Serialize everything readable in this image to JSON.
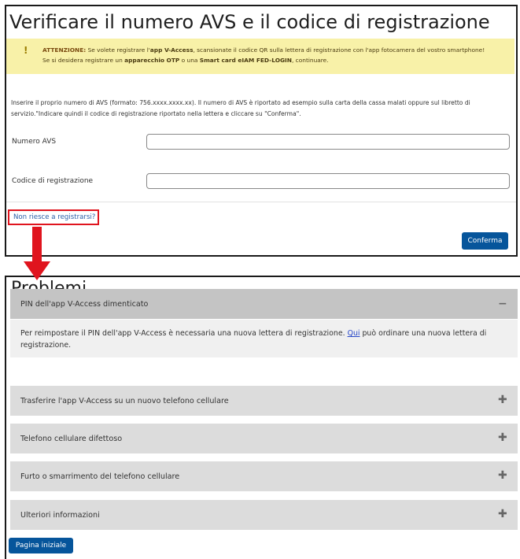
{
  "top": {
    "title": "Verificare il numero AVS e il codice di registrazione",
    "warning": {
      "mark": "!",
      "line1_prefix": "ATTENZIONE:",
      "line1_a": " Se volete registrare l'",
      "line1_b": "app V-Access",
      "line1_c": ", scansionate il codice QR sulla lettera di registrazione con l'app fotocamera del vostro smartphone!",
      "line2_a": "Se si desidera registrare un ",
      "line2_b": "apparecchio OTP",
      "line2_c": " o una ",
      "line2_d": "Smart card eIAM FED-LOGIN",
      "line2_e": ", continuare."
    },
    "instructions_line1": "Inserire il proprio numero di AVS (formato: 756.xxxx.xxxx.xx). Il numero di AVS è riportato ad esempio sulla carta della cassa malati oppure sul libretto di",
    "instructions_line2": "servizio.\"Indicare quindi il codice di registrazione riportato nella lettera e cliccare su \"Conferma\".",
    "field_avs_label": "Numero AVS",
    "field_avs_value": "",
    "field_code_label": "Codice di registrazione",
    "field_code_value": "",
    "help_link": "Non riesce a registrarsi?",
    "confirm_button": "Conferma"
  },
  "bottom": {
    "title": "Problemi",
    "accordion": [
      {
        "label": "PIN dell'app V-Access dimenticato",
        "icon": "minus-icon",
        "expanded": true,
        "body_a": "Per reimpostare il PIN dell'app V-Access è necessaria una nuova lettera di registrazione. ",
        "body_link": "Qui",
        "body_b": " può ordinare una nuova lettera di",
        "body_c": "registrazione."
      },
      {
        "label": "Trasferire l'app V-Access su un nuovo telefono cellulare",
        "icon": "plus-icon",
        "expanded": false
      },
      {
        "label": "Telefono cellulare difettoso",
        "icon": "plus-icon",
        "expanded": false
      },
      {
        "label": "Furto o smarrimento del telefono cellulare",
        "icon": "plus-icon",
        "expanded": false
      },
      {
        "label": "Ulteriori informazioni",
        "icon": "plus-icon",
        "expanded": false
      }
    ],
    "home_button": "Pagina iniziale"
  },
  "icons": {
    "minus": "−",
    "plus": "✚"
  },
  "colors": {
    "primary": "#06559b",
    "warning_bg": "#f8f1a8",
    "highlight": "#e0141e",
    "accordion_bg": "#dcdcdc"
  }
}
